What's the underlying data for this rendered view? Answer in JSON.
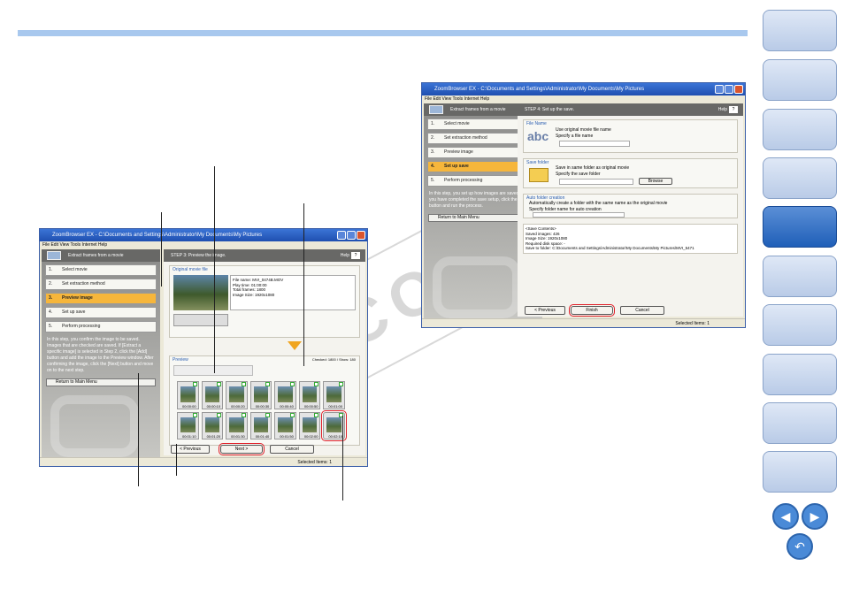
{
  "side_nav": {
    "active_index": 4,
    "count": 10
  },
  "prev_label": "◀",
  "next_label": "▶",
  "home_icon": "↶",
  "watermark": "COPY",
  "win1": {
    "title": "ZoomBrowser EX  -  C:\\Documents and Settings\\Administrator\\My Documents\\My Pictures",
    "menu": "File  Edit  View  Tools  Internet  Help",
    "side_title": "Extract frames from a movie",
    "steps": [
      "Select movie",
      "Set extraction method",
      "Preview image",
      "Set up save",
      "Perform processing"
    ],
    "step_nums": [
      "1.",
      "2.",
      "3.",
      "4.",
      "5."
    ],
    "side_text": "In this step, you confirm the image to be saved. Images that are checked are saved. If [Extract a specific image] is selected in Step 2, click the [Add] button and add the image to the Preview window. After confirming the image, click the [Next] button and move on to the next step.",
    "return_label": "Return to Main Menu",
    "step_title": "STEP 3: Preview the image.",
    "help": "Help",
    "help_btn": "?",
    "orig_group": "Original movie file",
    "file_info": "File name: MVI_0474B.MOV\nPlay time: 01:00:00\nTotal frames: 1800\nImage Size: 1920x1080",
    "preview_label": "Preview",
    "checked_label": "Checked: 1800 / Show: 180",
    "thumb_times": [
      "00:00:00",
      "00:00:10",
      "00:00:20",
      "00:00:30",
      "00:00:40",
      "00:00:50",
      "00:01:00",
      "00:01:10",
      "00:01:20",
      "00:01:30",
      "00:01:40",
      "00:01:50",
      "00:02:00",
      "00:02:10"
    ],
    "prev_btn": "< Previous",
    "next_btn": "Next >",
    "cancel_btn": "Cancel",
    "status": "Selected Items: 1"
  },
  "win2": {
    "title": "ZoomBrowser EX  -  C:\\Documents and Settings\\Administrator\\My Documents\\My Pictures",
    "menu": "File  Edit  View  Tools  Internet  Help",
    "side_title": "Extract frames from a movie",
    "steps": [
      "Select movie",
      "Set extraction method",
      "Preview image",
      "Set up save",
      "Perform processing"
    ],
    "step_nums": [
      "1.",
      "2.",
      "3.",
      "4.",
      "5."
    ],
    "side_text": "In this step, you set up how images are saved. When you have completed the save setup, click the [Finish] button and run the process.",
    "return_label": "Return to Main Menu",
    "step_title": "STEP 4: Set up the save.",
    "help": "Help",
    "help_btn": "?",
    "file_name_group": "File Name",
    "abc": "abc",
    "opt_original": "Use original movie file name",
    "opt_specify": "Specify a file name",
    "save_folder_group": "Save folder",
    "opt_same_folder": "Save in same folder as original movie",
    "opt_specify_folder": "Specify the save folder",
    "browse": "Browse",
    "auto_group": "Auto folder creation",
    "opt_auto": "Automatically create a folder with the same name as the original movie",
    "opt_auto_specify": "Specify folder name for auto creation",
    "save_contents": "<Save Contents>\nSaved images: 426\nImage Size: 1920x1080\nRequired disk space: -\nSave to folder: C:\\Documents and Settings\\Administrator\\My Documents\\My Pictures\\MVI_5471",
    "prev_btn": "< Previous",
    "finish_btn": "Finish",
    "cancel_btn": "Cancel",
    "status": "Selected Items: 1"
  }
}
